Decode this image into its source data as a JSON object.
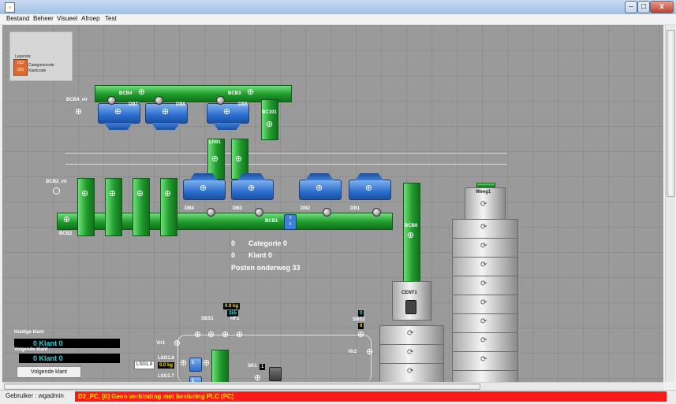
{
  "window": {
    "minimize": "–",
    "maximize": "□",
    "close": "x"
  },
  "menu": [
    "Bestand",
    "Beheer",
    "Visueel",
    "Afroep",
    "Test"
  ],
  "legend": {
    "title": "Legenda:",
    "line1": "Categoriecode",
    "line2": "Klantcode",
    "swatch_top": "012",
    "swatch_bottom": "023",
    "color": "#e06a2c"
  },
  "labels": {
    "bcb4": "BCB4",
    "bcb3": "BCB3",
    "bcb4_vir": "BCB4_vir",
    "db7": "DB7",
    "db6": "DB6",
    "db5": "DB5",
    "bc101": "BC101",
    "lr81": "LR81",
    "bcb2_vir": "BCB2_vir",
    "bcb2": "BCB2",
    "db4": "DB4",
    "db3": "DB3",
    "db2": "DB2",
    "db1": "DB1",
    "bcb1": "BCB1",
    "bcb0": "BCB0",
    "weeg1": "Weeg1",
    "cent1": "CENT1",
    "sbs1": "SBS1",
    "hf1": "HF1",
    "sbs2": "SBS2",
    "vir1": "Vir1",
    "vir2": "Vir2",
    "lsg18": "LSG1.8",
    "lsg17": "LSG1.7",
    "sk1": "SK1"
  },
  "info": {
    "cat_count": "0",
    "cat_label": "Categorie 0",
    "klant_count": "0",
    "klant_label": "Klant 0",
    "posten": "Posten onderweg  33"
  },
  "customers": {
    "huidige_title": "Huidige klant",
    "huidige_value": "0 Klant 0",
    "volgende_title": "Volgende klant",
    "volgende_value": "0 Klant 0",
    "button": "Volgende klant"
  },
  "readouts": {
    "kg_top": "0.0 kg",
    "cyan_top": "255",
    "kg_side": "0.0 kg",
    "sbs2_top": "0",
    "sbs2_bottom": "0",
    "sk1_value": "1",
    "lsg18_value": "1",
    "lsg17_value": "1"
  },
  "colors": {
    "pipe": "#1f9a2b",
    "hopper": "#2b6ed0",
    "alarm": "#ff1a1a",
    "alarm_text": "#ffe600",
    "klant_text": "#27d0d8"
  },
  "status": {
    "user": "Gebruiker : wgadmin",
    "alarm": "D2_PC,  [0] Geen verbinding met besturing PLC (PC)"
  }
}
